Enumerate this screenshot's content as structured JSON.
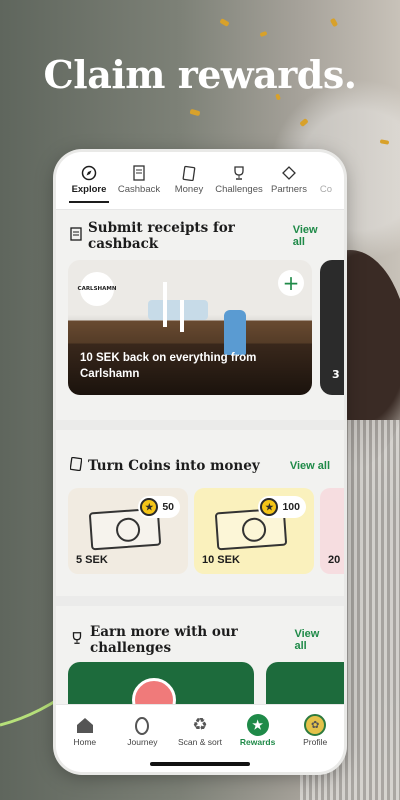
{
  "headline": "Claim rewards.",
  "colors": {
    "accent": "#1f8a48",
    "coin": "#f5c518",
    "challenge_bg": "#1d6b3c"
  },
  "top_tabs": [
    {
      "label": "Explore",
      "icon": "compass-icon",
      "active": true
    },
    {
      "label": "Cashback",
      "icon": "receipt-icon",
      "active": false
    },
    {
      "label": "Money",
      "icon": "wallet-icon",
      "active": false
    },
    {
      "label": "Challenges",
      "icon": "trophy-icon",
      "active": false
    },
    {
      "label": "Partners",
      "icon": "tag-icon",
      "active": false
    },
    {
      "label": "Co",
      "icon": "",
      "active": false
    }
  ],
  "cashback": {
    "title": "Submit receipts for cashback",
    "view_all": "View all",
    "card": {
      "brand": "CARLSHAMN",
      "text": "10 SEK back on everything from Carlshamn"
    },
    "peek_text": "3"
  },
  "coins": {
    "title": "Turn Coins into money",
    "view_all": "View all",
    "cards": [
      {
        "amount": "50",
        "label": "5 SEK",
        "bg": "#f1ebe1"
      },
      {
        "amount": "100",
        "label": "10 SEK",
        "bg": "#faf1bd"
      }
    ],
    "peek_label": "20"
  },
  "challenges": {
    "title": "Earn more with our challenges",
    "view_all": "View all"
  },
  "bottom_nav": [
    {
      "label": "Home",
      "icon": "home-icon",
      "active": false
    },
    {
      "label": "Journey",
      "icon": "egg-icon",
      "active": false
    },
    {
      "label": "Scan & sort",
      "icon": "recycle-icon",
      "active": false
    },
    {
      "label": "Rewards",
      "icon": "rewards-icon",
      "active": true
    },
    {
      "label": "Profile",
      "icon": "avatar-icon",
      "active": false
    }
  ]
}
